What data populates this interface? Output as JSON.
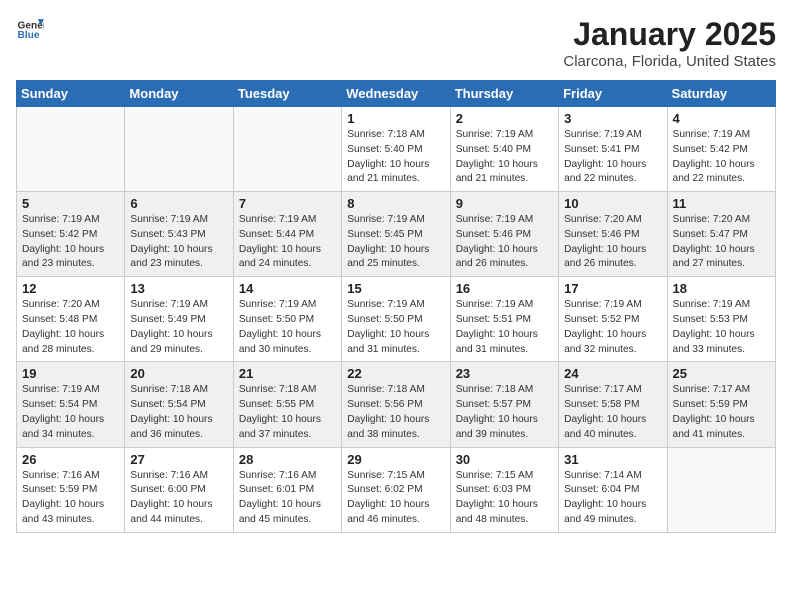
{
  "header": {
    "logo_general": "General",
    "logo_blue": "Blue",
    "month_title": "January 2025",
    "location": "Clarcona, Florida, United States"
  },
  "weekdays": [
    "Sunday",
    "Monday",
    "Tuesday",
    "Wednesday",
    "Thursday",
    "Friday",
    "Saturday"
  ],
  "weeks": [
    [
      {
        "day": "",
        "info": ""
      },
      {
        "day": "",
        "info": ""
      },
      {
        "day": "",
        "info": ""
      },
      {
        "day": "1",
        "info": "Sunrise: 7:18 AM\nSunset: 5:40 PM\nDaylight: 10 hours\nand 21 minutes."
      },
      {
        "day": "2",
        "info": "Sunrise: 7:19 AM\nSunset: 5:40 PM\nDaylight: 10 hours\nand 21 minutes."
      },
      {
        "day": "3",
        "info": "Sunrise: 7:19 AM\nSunset: 5:41 PM\nDaylight: 10 hours\nand 22 minutes."
      },
      {
        "day": "4",
        "info": "Sunrise: 7:19 AM\nSunset: 5:42 PM\nDaylight: 10 hours\nand 22 minutes."
      }
    ],
    [
      {
        "day": "5",
        "info": "Sunrise: 7:19 AM\nSunset: 5:42 PM\nDaylight: 10 hours\nand 23 minutes."
      },
      {
        "day": "6",
        "info": "Sunrise: 7:19 AM\nSunset: 5:43 PM\nDaylight: 10 hours\nand 23 minutes."
      },
      {
        "day": "7",
        "info": "Sunrise: 7:19 AM\nSunset: 5:44 PM\nDaylight: 10 hours\nand 24 minutes."
      },
      {
        "day": "8",
        "info": "Sunrise: 7:19 AM\nSunset: 5:45 PM\nDaylight: 10 hours\nand 25 minutes."
      },
      {
        "day": "9",
        "info": "Sunrise: 7:19 AM\nSunset: 5:46 PM\nDaylight: 10 hours\nand 26 minutes."
      },
      {
        "day": "10",
        "info": "Sunrise: 7:20 AM\nSunset: 5:46 PM\nDaylight: 10 hours\nand 26 minutes."
      },
      {
        "day": "11",
        "info": "Sunrise: 7:20 AM\nSunset: 5:47 PM\nDaylight: 10 hours\nand 27 minutes."
      }
    ],
    [
      {
        "day": "12",
        "info": "Sunrise: 7:20 AM\nSunset: 5:48 PM\nDaylight: 10 hours\nand 28 minutes."
      },
      {
        "day": "13",
        "info": "Sunrise: 7:19 AM\nSunset: 5:49 PM\nDaylight: 10 hours\nand 29 minutes."
      },
      {
        "day": "14",
        "info": "Sunrise: 7:19 AM\nSunset: 5:50 PM\nDaylight: 10 hours\nand 30 minutes."
      },
      {
        "day": "15",
        "info": "Sunrise: 7:19 AM\nSunset: 5:50 PM\nDaylight: 10 hours\nand 31 minutes."
      },
      {
        "day": "16",
        "info": "Sunrise: 7:19 AM\nSunset: 5:51 PM\nDaylight: 10 hours\nand 31 minutes."
      },
      {
        "day": "17",
        "info": "Sunrise: 7:19 AM\nSunset: 5:52 PM\nDaylight: 10 hours\nand 32 minutes."
      },
      {
        "day": "18",
        "info": "Sunrise: 7:19 AM\nSunset: 5:53 PM\nDaylight: 10 hours\nand 33 minutes."
      }
    ],
    [
      {
        "day": "19",
        "info": "Sunrise: 7:19 AM\nSunset: 5:54 PM\nDaylight: 10 hours\nand 34 minutes."
      },
      {
        "day": "20",
        "info": "Sunrise: 7:18 AM\nSunset: 5:54 PM\nDaylight: 10 hours\nand 36 minutes."
      },
      {
        "day": "21",
        "info": "Sunrise: 7:18 AM\nSunset: 5:55 PM\nDaylight: 10 hours\nand 37 minutes."
      },
      {
        "day": "22",
        "info": "Sunrise: 7:18 AM\nSunset: 5:56 PM\nDaylight: 10 hours\nand 38 minutes."
      },
      {
        "day": "23",
        "info": "Sunrise: 7:18 AM\nSunset: 5:57 PM\nDaylight: 10 hours\nand 39 minutes."
      },
      {
        "day": "24",
        "info": "Sunrise: 7:17 AM\nSunset: 5:58 PM\nDaylight: 10 hours\nand 40 minutes."
      },
      {
        "day": "25",
        "info": "Sunrise: 7:17 AM\nSunset: 5:59 PM\nDaylight: 10 hours\nand 41 minutes."
      }
    ],
    [
      {
        "day": "26",
        "info": "Sunrise: 7:16 AM\nSunset: 5:59 PM\nDaylight: 10 hours\nand 43 minutes."
      },
      {
        "day": "27",
        "info": "Sunrise: 7:16 AM\nSunset: 6:00 PM\nDaylight: 10 hours\nand 44 minutes."
      },
      {
        "day": "28",
        "info": "Sunrise: 7:16 AM\nSunset: 6:01 PM\nDaylight: 10 hours\nand 45 minutes."
      },
      {
        "day": "29",
        "info": "Sunrise: 7:15 AM\nSunset: 6:02 PM\nDaylight: 10 hours\nand 46 minutes."
      },
      {
        "day": "30",
        "info": "Sunrise: 7:15 AM\nSunset: 6:03 PM\nDaylight: 10 hours\nand 48 minutes."
      },
      {
        "day": "31",
        "info": "Sunrise: 7:14 AM\nSunset: 6:04 PM\nDaylight: 10 hours\nand 49 minutes."
      },
      {
        "day": "",
        "info": ""
      }
    ]
  ]
}
